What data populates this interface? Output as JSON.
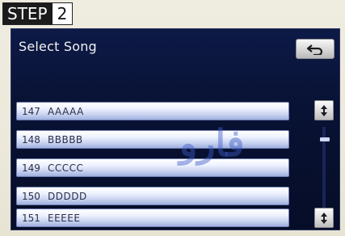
{
  "step_badge": {
    "word": "STEP",
    "number": "2"
  },
  "screen": {
    "title": "Select Song",
    "back_button": {
      "icon": "return-arrow-icon"
    },
    "songs": [
      {
        "number": "147",
        "name": "AAAAA"
      },
      {
        "number": "148",
        "name": "BBBBB"
      },
      {
        "number": "149",
        "name": "CCCCC"
      },
      {
        "number": "150",
        "name": "DDDDD"
      },
      {
        "number": "151",
        "name": "EEEEE"
      }
    ],
    "scroll_up_icon": "scroll-up-icon",
    "scroll_down_icon": "scroll-down-icon"
  },
  "watermark": {
    "text": "فارو"
  },
  "colors": {
    "screen_bg": "#0b1641",
    "row_highlight": "#c9d3ef",
    "text_dark": "#2a2f4a"
  }
}
